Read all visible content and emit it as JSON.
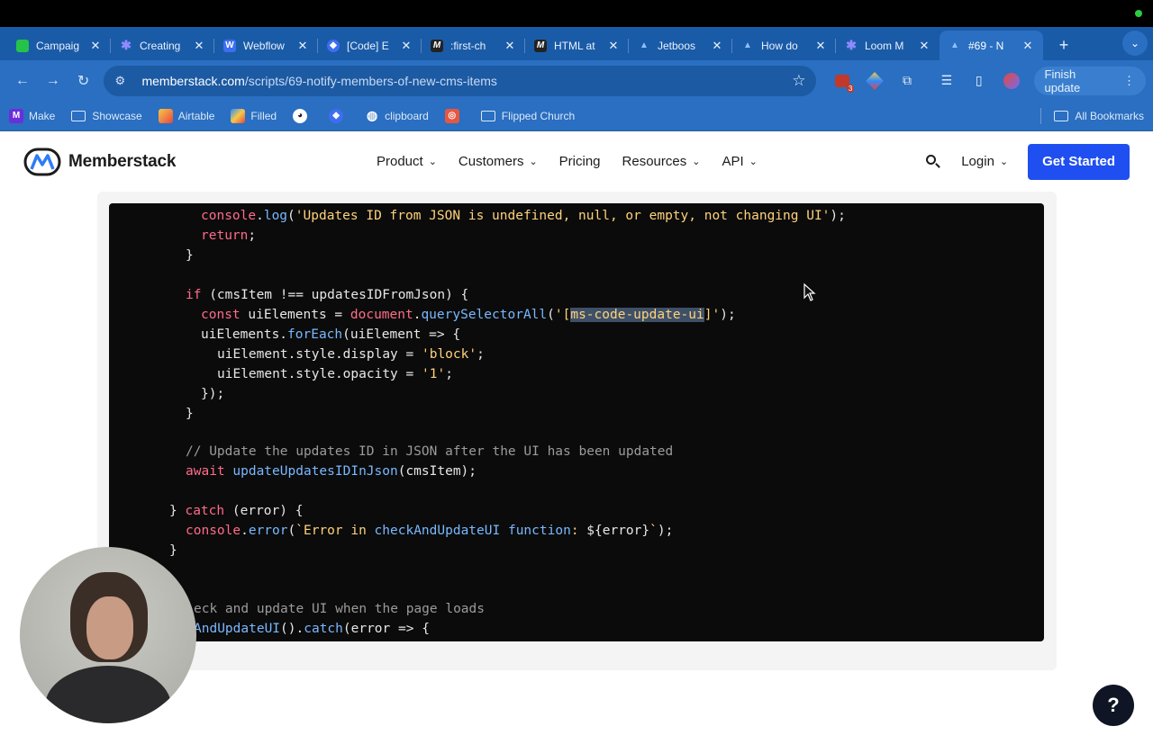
{
  "browser": {
    "tabs": [
      {
        "title": "Campaig",
        "icon": "chat-bubble-icon",
        "color": "#25c449"
      },
      {
        "title": "Creating",
        "icon": "asterisk-icon",
        "color": "#6f6bf2"
      },
      {
        "title": "Webflow",
        "icon": "webflow-icon",
        "color": "#3d6ef0"
      },
      {
        "title": "[Code] E",
        "icon": "diamond-icon",
        "color": "#3d6ef0"
      },
      {
        "title": ":first-ch",
        "icon": "m-icon",
        "color": "#222222"
      },
      {
        "title": "HTML at",
        "icon": "m-icon",
        "color": "#222222"
      },
      {
        "title": "Jetboos",
        "icon": "memberstack-icon",
        "color": "#8fbfff"
      },
      {
        "title": "How do",
        "icon": "memberstack-icon",
        "color": "#8fbfff"
      },
      {
        "title": "Loom M",
        "icon": "asterisk-icon",
        "color": "#6f6bf2"
      },
      {
        "title": "#69 - N",
        "icon": "memberstack-icon",
        "color": "#8fbfff",
        "active": true
      }
    ],
    "url_host": "memberstack.com",
    "url_path": "/scripts/69-notify-members-of-new-cms-items",
    "extension_badge": "3",
    "finish_update_label": "Finish update",
    "bookmarks": [
      {
        "label": "Make",
        "icon": "make-icon"
      },
      {
        "label": "Showcase",
        "icon": "folder-icon"
      },
      {
        "label": "Airtable",
        "icon": "airtable-icon"
      },
      {
        "label": "Filled",
        "icon": "filled-icon"
      },
      {
        "label": "",
        "icon": "panda-icon"
      },
      {
        "label": "",
        "icon": "diamond-icon"
      },
      {
        "label": "clipboard",
        "icon": "globe-icon"
      },
      {
        "label": "",
        "icon": "red-app-icon"
      },
      {
        "label": "Flipped Church",
        "icon": "folder-icon"
      }
    ],
    "all_bookmarks_label": "All Bookmarks"
  },
  "site": {
    "brand": "Memberstack",
    "nav": [
      {
        "label": "Product",
        "dropdown": true
      },
      {
        "label": "Customers",
        "dropdown": true
      },
      {
        "label": "Pricing",
        "dropdown": false
      },
      {
        "label": "Resources",
        "dropdown": true
      },
      {
        "label": "API",
        "dropdown": true
      }
    ],
    "login_label": "Login",
    "cta_label": "Get Started"
  },
  "code_lines": [
    "console.log('Updates ID from JSON is undefined, null, or empty, not changing UI');",
    "return;",
    "}",
    "if (cmsItem !== updatesIDFromJson) {",
    "const uiElements = document.querySelectorAll('[ms-code-update-ui]');",
    "uiElements.forEach(uiElement => {",
    "uiElement.style.display = 'block';",
    "uiElement.style.opacity = '1';",
    "});",
    "}",
    "// Update the updates ID in JSON after the UI has been updated",
    "await updateUpdatesIDInJson(cmsItem);",
    "} catch (error) {",
    "console.error(`Error in checkAndUpdateUI function: ${error}`);",
    "}",
    "eck and update UI when the page loads",
    "AndUpdateUI().catch(error => {"
  ],
  "help_label": "?"
}
